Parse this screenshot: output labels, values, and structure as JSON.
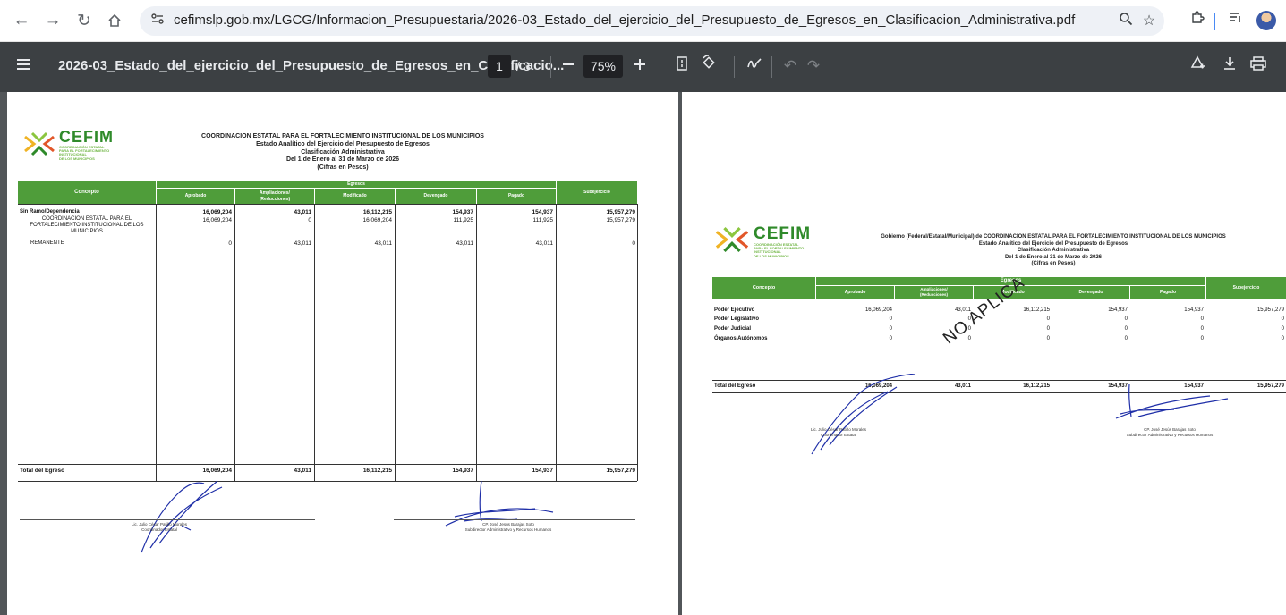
{
  "browser": {
    "url": "cefimslp.gob.mx/LGCG/Informacion_Presupuestaria/2026-03_Estado_del_ejercicio_del_Presupuesto_de_Egresos_en_Clasificacion_Administrativa.pdf"
  },
  "toolbar": {
    "title": "2026-03_Estado_del_ejercicio_del_Presupuesto_de_Egresos_en_Clasificacio...",
    "page_current": "1",
    "page_total": "/ 3",
    "zoom": "75%"
  },
  "page1": {
    "logo": {
      "word": "CEFIM",
      "sub": "COORDINACIÓN ESTATAL\nPARA EL FORTALECIMIENTO\nINSTITUCIONAL\nDE LOS MUNICIPIOS"
    },
    "header": {
      "line1": "COORDINACION ESTATAL PARA EL FORTALECIMIENTO INSTITUCIONAL DE LOS MUNICIPIOS",
      "line2": "Estado Analítico del Ejercicio del Presupuesto de Egresos",
      "line3": "Clasificación Administrativa",
      "line4": "Del 1 de Enero al 31 de Marzo de 2026",
      "line5": "(Cifras en Pesos)"
    },
    "columns": {
      "concepto": "Concepto",
      "egresos": "Egresos",
      "aprobado": "Aprobado",
      "ampliaciones": "Ampliaciones/\n(Reducciones)",
      "modificado": "Modificado",
      "devengado": "Devengado",
      "pagado": "Pagado",
      "subejercicio": "Subejercicio"
    },
    "rows": [
      {
        "concepto": "Sin Ramo/Dependencia",
        "aprobado": "16,069,204",
        "ampliaciones": "43,011",
        "modificado": "16,112,215",
        "devengado": "154,937",
        "pagado": "154,937",
        "subejercicio": "15,957,279"
      },
      {
        "concepto": "COORDINACIÓN ESTATAL PARA EL\nFORTALECIMIENTO INSTITUCIONAL DE LOS\nMUNICIPIOS",
        "aprobado": "16,069,204",
        "ampliaciones": "0",
        "modificado": "16,069,204",
        "devengado": "111,925",
        "pagado": "111,925",
        "subejercicio": "15,957,279"
      },
      {
        "concepto": "REMANENTE",
        "aprobado": "0",
        "ampliaciones": "43,011",
        "modificado": "43,011",
        "devengado": "43,011",
        "pagado": "43,011",
        "subejercicio": "0"
      }
    ],
    "total": {
      "concepto": "Total del Egreso",
      "aprobado": "16,069,204",
      "ampliaciones": "43,011",
      "modificado": "16,112,215",
      "devengado": "154,937",
      "pagado": "154,937",
      "subejercicio": "15,957,279"
    },
    "signatures": {
      "left": "Lic. Julio César Patiño Morales\nCoordinador Estatal",
      "right": "CP. José Jesús Barajas Soto\nSubdirector Administrativo y Recursos Humanos"
    }
  },
  "page2": {
    "logo": {
      "word": "CEFIM",
      "sub": "COORDINACIÓN ESTATAL\nPARA EL FORTALECIMIENTO\nINSTITUCIONAL\nDE LOS MUNICIPIOS"
    },
    "header": {
      "line1": "Gobierno (Federal/Estatal/Municipal) de COORDINACION ESTATAL PARA EL FORTALECIMIENTO INSTITUCIONAL DE LOS MUNICIPIOS",
      "line2": "Estado Analítico del Ejercicio del Presupuesto de Egresos",
      "line3": "Clasificación Administrativa",
      "line4": "Del 1 de Enero al 31 de Marzo de 2026",
      "line5": "(Cifras en Pesos)"
    },
    "columns": {
      "concepto": "Concepto",
      "egresos": "Egresos",
      "aprobado": "Aprobado",
      "ampliaciones": "Ampliaciones/\n(Reducciones)",
      "modificado": "Modificado",
      "devengado": "Devengado",
      "pagado": "Pagado",
      "subejercicio": "Subejercicio"
    },
    "rows": [
      {
        "concepto": "Poder Ejecutivo",
        "aprobado": "16,069,204",
        "ampliaciones": "43,011",
        "modificado": "16,112,215",
        "devengado": "154,937",
        "pagado": "154,937",
        "subejercicio": "15,957,279"
      },
      {
        "concepto": "Poder Legislativo",
        "aprobado": "0",
        "ampliaciones": "0",
        "modificado": "0",
        "devengado": "0",
        "pagado": "0",
        "subejercicio": "0"
      },
      {
        "concepto": "Poder Judicial",
        "aprobado": "0",
        "ampliaciones": "0",
        "modificado": "0",
        "devengado": "0",
        "pagado": "0",
        "subejercicio": "0"
      },
      {
        "concepto": "Órganos Autónomos",
        "aprobado": "0",
        "ampliaciones": "0",
        "modificado": "0",
        "devengado": "0",
        "pagado": "0",
        "subejercicio": "0"
      }
    ],
    "total": {
      "concepto": "Total del Egreso",
      "aprobado": "16,069,204",
      "ampliaciones": "43,011",
      "modificado": "16,112,215",
      "devengado": "154,937",
      "pagado": "154,937",
      "subejercicio": "15,957,279"
    },
    "stamp": "NO APLICA",
    "signatures": {
      "left": "Lic. Julio César Patiño Morales\nCoordinador Estatal",
      "right": "CP. José Jesús Barajas Soto\nSubdirector Administrativo y Recursos Humanos"
    }
  },
  "colors": {
    "table_header_green": "#4f9d3a",
    "toolbar": "#3c4043",
    "viewer_bg": "#525659",
    "signature_ink": "#1f2fa8"
  },
  "icons": [
    "back-arrow-icon",
    "forward-arrow-icon",
    "reload-icon",
    "home-icon",
    "site-info-icon",
    "zoom-magnifier-icon",
    "bookmark-star-icon",
    "extensions-puzzle-icon",
    "reading-list-icon",
    "profile-avatar",
    "menu-hamburger-icon",
    "zoom-out-icon",
    "zoom-in-icon",
    "fit-page-icon",
    "rotate-icon",
    "annotate-pen-icon",
    "undo-icon",
    "redo-icon",
    "add-annotation-icon",
    "download-icon",
    "print-icon"
  ]
}
